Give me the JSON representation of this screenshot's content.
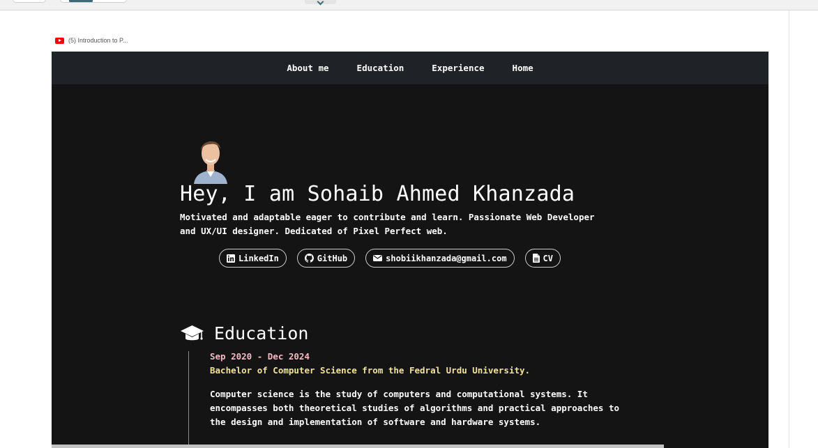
{
  "browser": {
    "tab_label": "(5) Introduction to P..."
  },
  "nav": {
    "items": [
      "About me",
      "Education",
      "Experience",
      "Home"
    ]
  },
  "hero": {
    "title": "Hey, I am Sohaib Ahmed Khanzada",
    "description": "Motivated and adaptable eager to contribute and learn. Passionate Web Developer and UX/UI designer. Dedicated of Pixel Perfect web."
  },
  "links": {
    "linkedin": "LinkedIn",
    "github": "GitHub",
    "email": "shobiikhanzada@gmail.com",
    "cv": "CV"
  },
  "education": {
    "heading": "Education",
    "date": "Sep 2020 - Dec 2024",
    "degree": "Bachelor of Computer Science from the Fedral Urdu University.",
    "description": "Computer science is the study of computers and computational systems. It encompasses both theoretical studies of algorithms and practical approaches to the design and implementation of software and hardware systems."
  },
  "icons": {
    "tab": "youtube-icon",
    "linkedin": "linkedin-icon",
    "github": "github-icon",
    "email": "envelope-icon",
    "cv": "document-icon",
    "education": "graduation-cap-icon"
  },
  "colors": {
    "site_background": "#141414",
    "navbar_background": "#1f2328",
    "date_accent": "#f7b9c4",
    "degree_accent": "#f3e29a"
  }
}
